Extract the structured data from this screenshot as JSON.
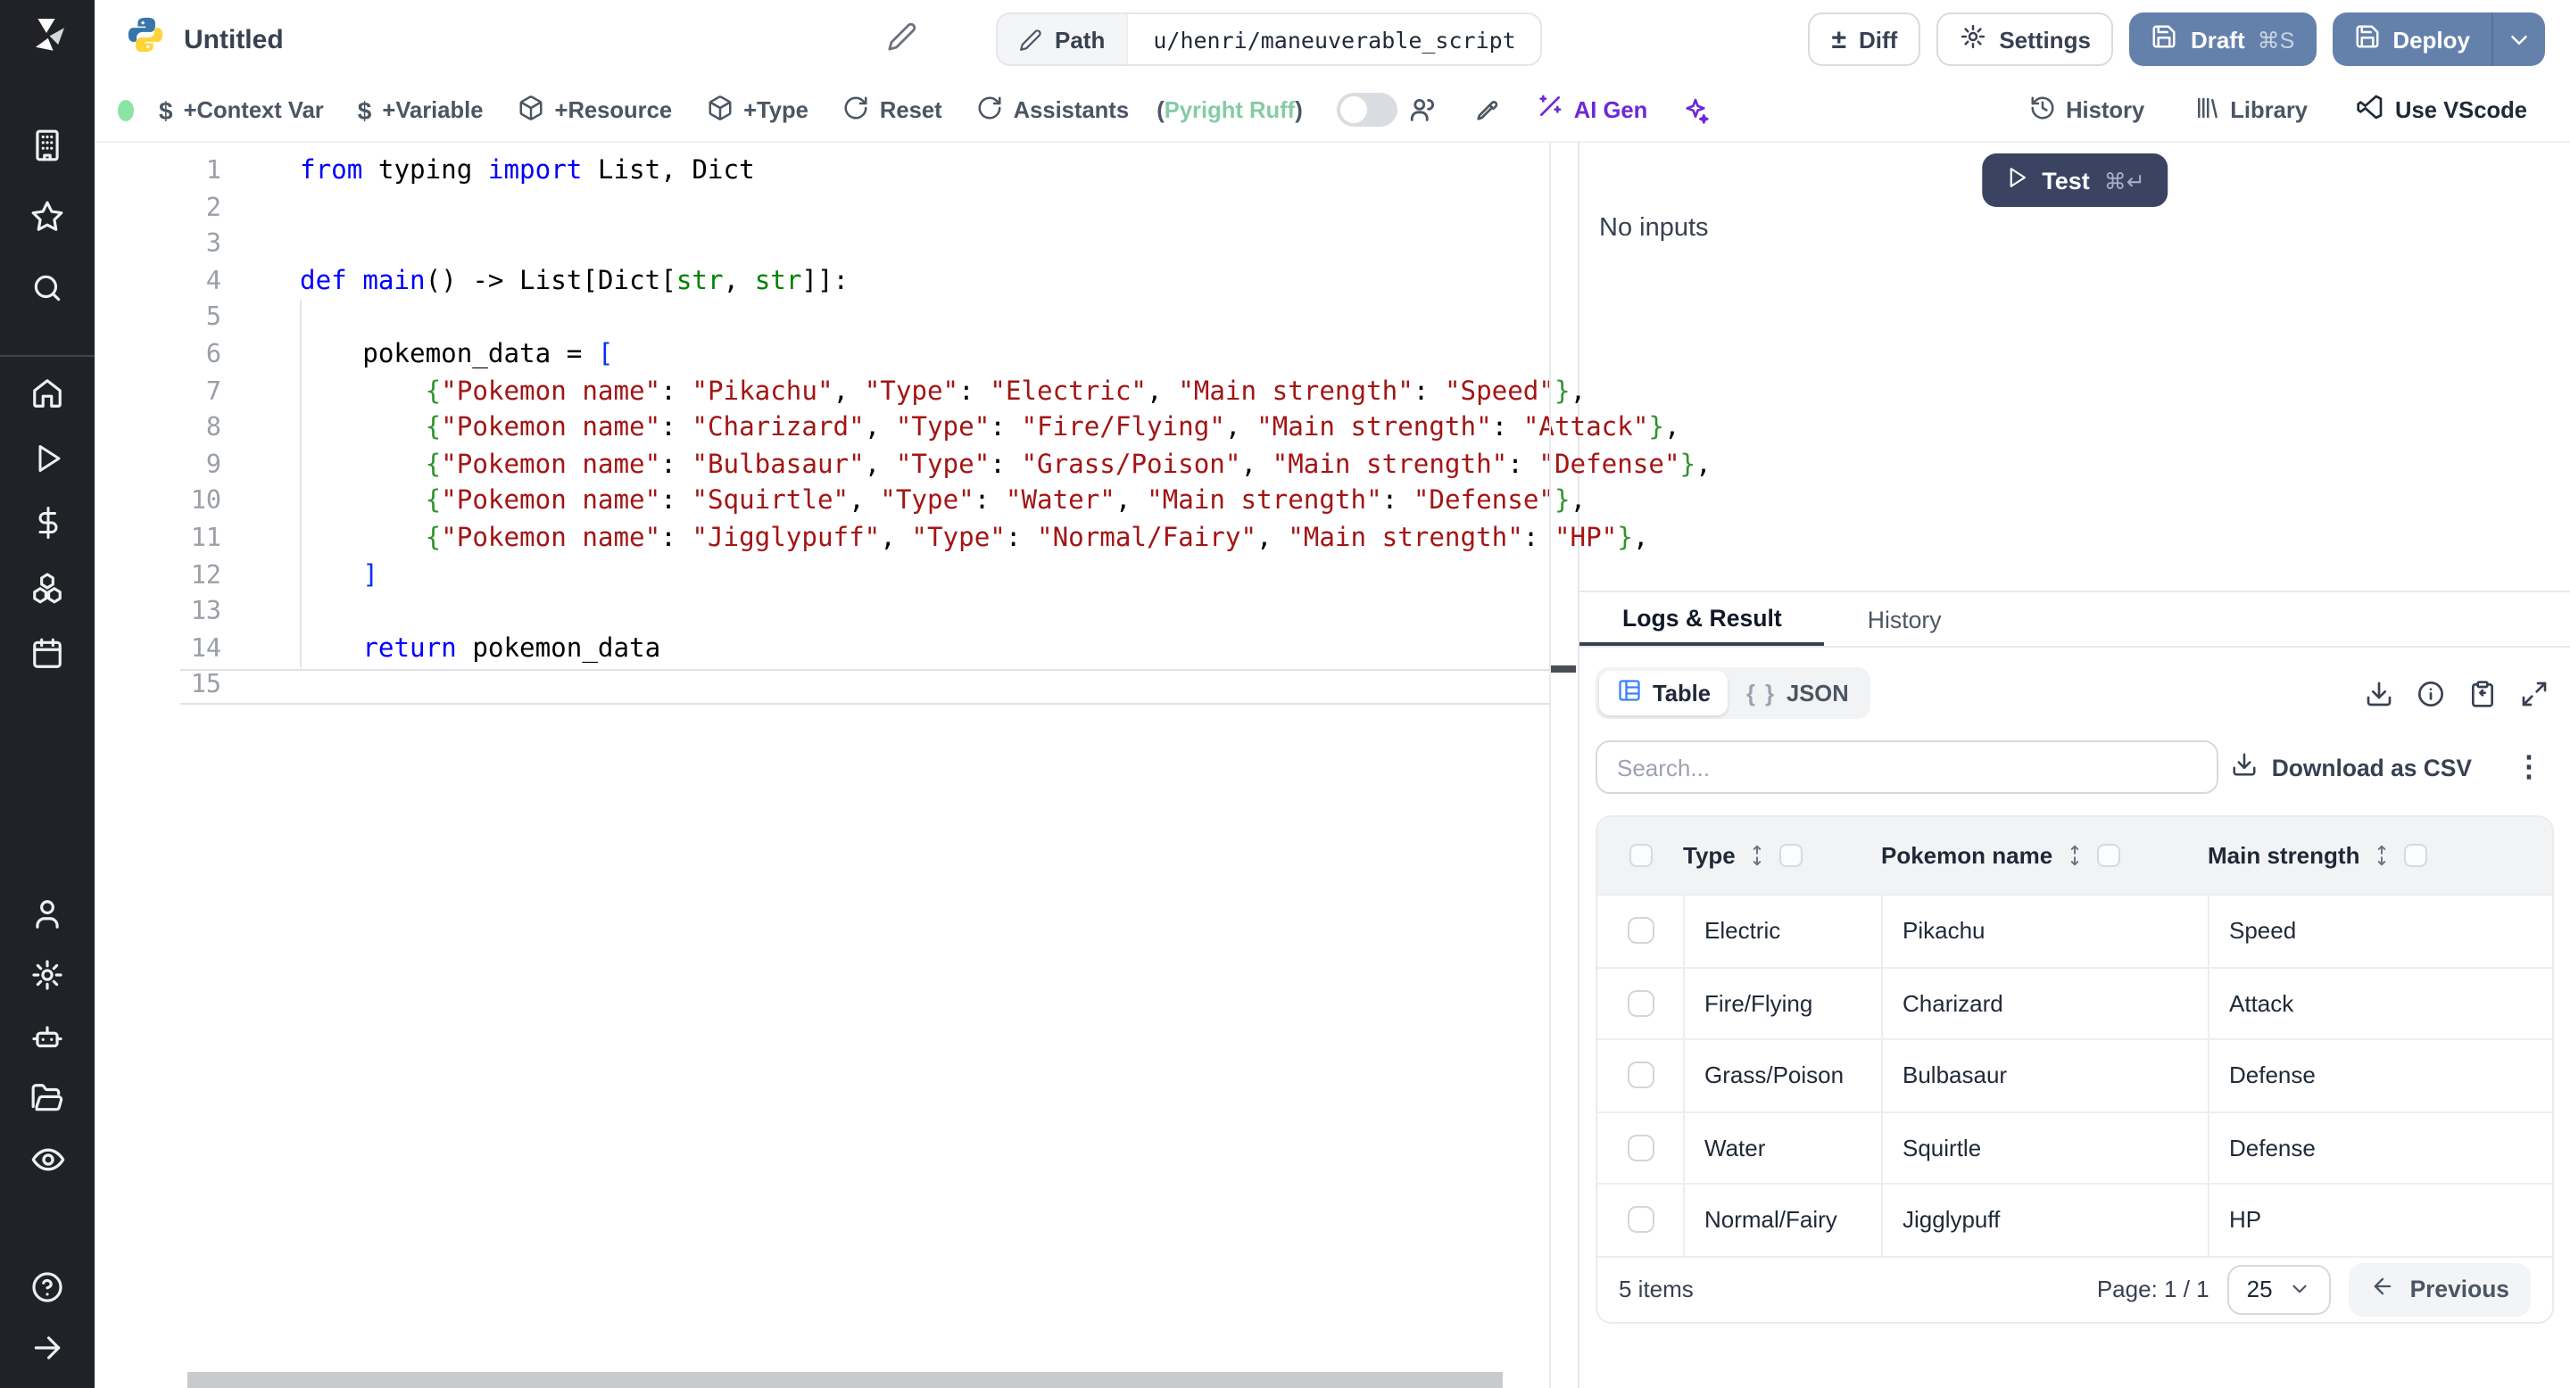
{
  "topbar": {
    "title": "Untitled",
    "path_label": "Path",
    "path_value": "u/henri/maneuverable_script",
    "diff_label": "Diff",
    "diff_symbol": "±",
    "settings_label": "Settings",
    "draft_label": "Draft",
    "draft_kbd": "⌘S",
    "deploy_label": "Deploy"
  },
  "toolbar": {
    "context_var": "+Context Var",
    "variable": "+Variable",
    "resource": "+Resource",
    "type": "+Type",
    "reset": "Reset",
    "assistants": "Assistants",
    "assistants_paren_open": "(",
    "assistants_detail": "Pyright Ruff",
    "assistants_paren_close": ")",
    "ai_gen": "AI Gen",
    "history": "History",
    "library": "Library",
    "vscode": "Use VScode",
    "dollar_glyph": "$"
  },
  "editor": {
    "language": "python",
    "lines": [
      {
        "n": "1",
        "tokens": [
          [
            "k",
            "from"
          ],
          [
            "p",
            " typing "
          ],
          [
            "k",
            "import"
          ],
          [
            "p",
            " List, Dict"
          ]
        ]
      },
      {
        "n": "2",
        "tokens": []
      },
      {
        "n": "3",
        "tokens": []
      },
      {
        "n": "4",
        "tokens": [
          [
            "k",
            "def"
          ],
          [
            "p",
            " "
          ],
          [
            "k",
            "main"
          ],
          [
            "p",
            "() -> List[Dict["
          ],
          [
            "ty",
            "str"
          ],
          [
            "p",
            ", "
          ],
          [
            "ty",
            "str"
          ],
          [
            "p",
            "]]:"
          ]
        ]
      },
      {
        "n": "5",
        "tokens": []
      },
      {
        "n": "6",
        "tokens": [
          [
            "p",
            "    pokemon_data = "
          ],
          [
            "bb",
            "["
          ]
        ]
      },
      {
        "n": "7",
        "tokens": [
          [
            "p",
            "        "
          ],
          [
            "gb",
            "{"
          ],
          [
            "s",
            "\"Pokemon name\""
          ],
          [
            "p",
            ": "
          ],
          [
            "s",
            "\"Pikachu\""
          ],
          [
            "p",
            ", "
          ],
          [
            "s",
            "\"Type\""
          ],
          [
            "p",
            ": "
          ],
          [
            "s",
            "\"Electric\""
          ],
          [
            "p",
            ", "
          ],
          [
            "s",
            "\"Main strength\""
          ],
          [
            "p",
            ": "
          ],
          [
            "s",
            "\"Speed\""
          ],
          [
            "gb",
            "}"
          ],
          [
            "p",
            ","
          ]
        ]
      },
      {
        "n": "8",
        "tokens": [
          [
            "p",
            "        "
          ],
          [
            "gb",
            "{"
          ],
          [
            "s",
            "\"Pokemon name\""
          ],
          [
            "p",
            ": "
          ],
          [
            "s",
            "\"Charizard\""
          ],
          [
            "p",
            ", "
          ],
          [
            "s",
            "\"Type\""
          ],
          [
            "p",
            ": "
          ],
          [
            "s",
            "\"Fire/Flying\""
          ],
          [
            "p",
            ", "
          ],
          [
            "s",
            "\"Main strength\""
          ],
          [
            "p",
            ": "
          ],
          [
            "s",
            "\"Attack\""
          ],
          [
            "gb",
            "}"
          ],
          [
            "p",
            ","
          ]
        ]
      },
      {
        "n": "9",
        "tokens": [
          [
            "p",
            "        "
          ],
          [
            "gb",
            "{"
          ],
          [
            "s",
            "\"Pokemon name\""
          ],
          [
            "p",
            ": "
          ],
          [
            "s",
            "\"Bulbasaur\""
          ],
          [
            "p",
            ", "
          ],
          [
            "s",
            "\"Type\""
          ],
          [
            "p",
            ": "
          ],
          [
            "s",
            "\"Grass/Poison\""
          ],
          [
            "p",
            ", "
          ],
          [
            "s",
            "\"Main strength\""
          ],
          [
            "p",
            ": "
          ],
          [
            "s",
            "\"Defense\""
          ],
          [
            "gb",
            "}"
          ],
          [
            "p",
            ","
          ]
        ]
      },
      {
        "n": "10",
        "tokens": [
          [
            "p",
            "        "
          ],
          [
            "gb",
            "{"
          ],
          [
            "s",
            "\"Pokemon name\""
          ],
          [
            "p",
            ": "
          ],
          [
            "s",
            "\"Squirtle\""
          ],
          [
            "p",
            ", "
          ],
          [
            "s",
            "\"Type\""
          ],
          [
            "p",
            ": "
          ],
          [
            "s",
            "\"Water\""
          ],
          [
            "p",
            ", "
          ],
          [
            "s",
            "\"Main strength\""
          ],
          [
            "p",
            ": "
          ],
          [
            "s",
            "\"Defense\""
          ],
          [
            "gb",
            "}"
          ],
          [
            "p",
            ","
          ]
        ]
      },
      {
        "n": "11",
        "tokens": [
          [
            "p",
            "        "
          ],
          [
            "gb",
            "{"
          ],
          [
            "s",
            "\"Pokemon name\""
          ],
          [
            "p",
            ": "
          ],
          [
            "s",
            "\"Jigglypuff\""
          ],
          [
            "p",
            ", "
          ],
          [
            "s",
            "\"Type\""
          ],
          [
            "p",
            ": "
          ],
          [
            "s",
            "\"Normal/Fairy\""
          ],
          [
            "p",
            ", "
          ],
          [
            "s",
            "\"Main strength\""
          ],
          [
            "p",
            ": "
          ],
          [
            "s",
            "\"HP\""
          ],
          [
            "gb",
            "}"
          ],
          [
            "p",
            ","
          ]
        ]
      },
      {
        "n": "12",
        "tokens": [
          [
            "p",
            "    "
          ],
          [
            "bb",
            "]"
          ]
        ]
      },
      {
        "n": "13",
        "tokens": []
      },
      {
        "n": "14",
        "tokens": [
          [
            "p",
            "    "
          ],
          [
            "k",
            "return"
          ],
          [
            "p",
            " pokemon_data"
          ]
        ]
      },
      {
        "n": "15",
        "tokens": []
      }
    ]
  },
  "right_panel": {
    "test_label": "Test",
    "test_kbd": "⌘↵",
    "no_inputs": "No inputs",
    "tabs": {
      "logs": "Logs & Result",
      "history": "History"
    },
    "view_table": "Table",
    "view_json": "JSON",
    "json_braces": "{ }",
    "search_placeholder": "Search...",
    "download_csv": "Download as CSV",
    "kebab": "⋮",
    "footer": {
      "count": "5 items",
      "page_label": "Page: 1 / 1",
      "page_size": "25",
      "previous": "Previous"
    }
  },
  "table": {
    "columns": [
      "Type",
      "Pokemon name",
      "Main strength"
    ],
    "rows": [
      [
        "Electric",
        "Pikachu",
        "Speed"
      ],
      [
        "Fire/Flying",
        "Charizard",
        "Attack"
      ],
      [
        "Grass/Poison",
        "Bulbasaur",
        "Defense"
      ],
      [
        "Water",
        "Squirtle",
        "Defense"
      ],
      [
        "Normal/Fairy",
        "Jigglypuff",
        "HP"
      ]
    ]
  },
  "sidebar": {
    "icons": [
      "workspace-building",
      "favorites-star",
      "search",
      "home",
      "runs-play",
      "variables-dollar",
      "resources-boxes",
      "schedules-calendar",
      "user",
      "settings-gear",
      "workers-robot",
      "folders",
      "audit-eye",
      "help",
      "collapse-arrow"
    ]
  },
  "colors": {
    "accent_button": "#6481ab",
    "test_button": "#3a4462",
    "ai_purple": "#6d28d9",
    "assistant_green": "#84cba6",
    "table_icon_blue": "#3b82f6",
    "status_dot_green": "#8be3a4",
    "keyword_blue": "#0000ff",
    "string_red": "#a31515",
    "sidebar_dark": "#202227"
  }
}
